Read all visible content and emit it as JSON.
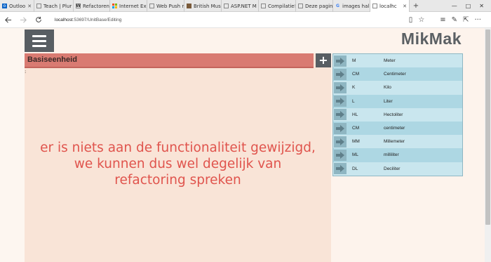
{
  "tabs": [
    {
      "label": "Outloo",
      "icon": "outlook-icon",
      "active": false
    },
    {
      "label": "Teach | Plur",
      "icon": "page-icon",
      "active": false
    },
    {
      "label": "Refactoren",
      "icon": "wikipedia-icon",
      "active": false
    },
    {
      "label": "Internet Ex",
      "icon": "windows-icon",
      "active": false
    },
    {
      "label": "Web Push r",
      "icon": "page-icon",
      "active": false
    },
    {
      "label": "British Mus",
      "icon": "museum-icon",
      "active": false
    },
    {
      "label": "ASP.NET M",
      "icon": "page-icon",
      "active": false
    },
    {
      "label": "Compilatie!",
      "icon": "page-icon",
      "active": false
    },
    {
      "label": "Deze pagin",
      "icon": "page-icon",
      "active": false
    },
    {
      "label": "images hall",
      "icon": "google-icon",
      "active": false
    },
    {
      "label": "localhc",
      "icon": "page-icon",
      "active": true
    }
  ],
  "address": {
    "host": "localhost",
    "path": ":53697/UnitBase/Editing"
  },
  "app": {
    "brand": "MikMak"
  },
  "panel": {
    "title": "Basiseenheid",
    "add_label": "+",
    "colon": ":",
    "message": "er is niets aan de functionaliteit gewijzigd, we kunnen dus wel degelijk van refactoring spreken"
  },
  "units": [
    {
      "code": "M",
      "name": "Meter"
    },
    {
      "code": "CM",
      "name": "Centimeter"
    },
    {
      "code": "K",
      "name": "Kilo"
    },
    {
      "code": "L",
      "name": "Liter"
    },
    {
      "code": "HL",
      "name": "Hectoliter"
    },
    {
      "code": "CM",
      "name": "centimeter"
    },
    {
      "code": "MM",
      "name": "Millemeter"
    },
    {
      "code": "ML",
      "name": "milliliter"
    },
    {
      "code": "DL",
      "name": "Deciliter"
    }
  ],
  "colors": {
    "header": "#d97b72",
    "panel_bg": "#f9e4d7",
    "message": "#e0544d",
    "brand": "#5b6064",
    "list_odd": "#c9e6ee",
    "list_even": "#add7e3"
  }
}
